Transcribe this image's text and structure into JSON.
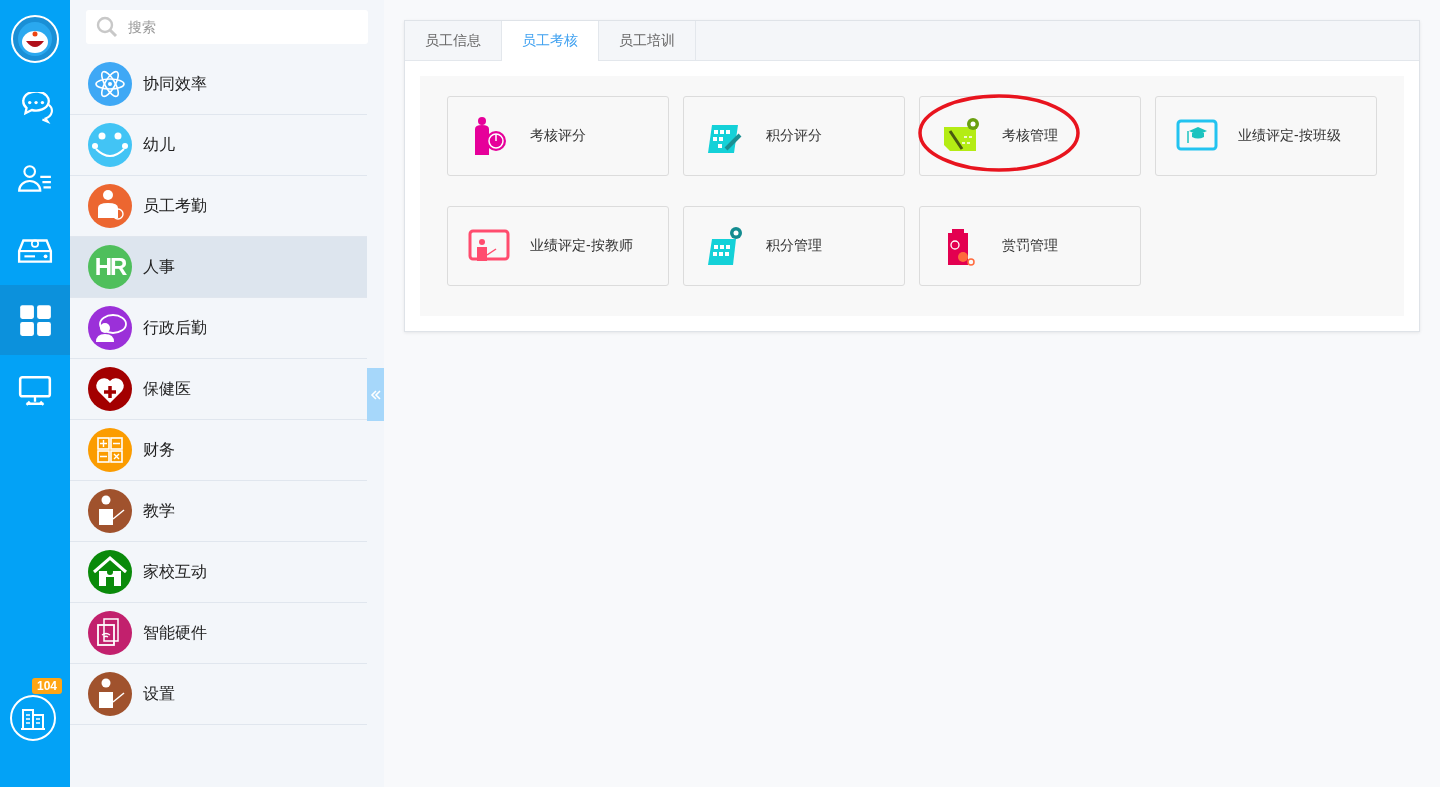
{
  "rail": {
    "items": [
      {
        "kind": "chat",
        "selected": false
      },
      {
        "kind": "contacts",
        "selected": false
      },
      {
        "kind": "drive",
        "selected": false
      },
      {
        "kind": "apps",
        "selected": true
      },
      {
        "kind": "monitor",
        "selected": false
      }
    ],
    "notification_badge": "104"
  },
  "sidebar": {
    "search": {
      "placeholder": "搜索"
    },
    "items": [
      {
        "label": "协同效率",
        "color": "#3ea8f5",
        "selected": false
      },
      {
        "label": "幼儿",
        "color": "#42c4f5",
        "selected": false
      },
      {
        "label": "员工考勤",
        "color": "#ec6630",
        "selected": false
      },
      {
        "label": "人事",
        "color": "#4fbf5c",
        "selected": true,
        "icon_text": "HR"
      },
      {
        "label": "行政后勤",
        "color": "#9b30d9",
        "selected": false
      },
      {
        "label": "保健医",
        "color": "#a30000",
        "selected": false
      },
      {
        "label": "财务",
        "color": "#fb9c00",
        "selected": false
      },
      {
        "label": "教学",
        "color": "#a0522d",
        "selected": false
      },
      {
        "label": "家校互动",
        "color": "#0a8a0a",
        "selected": false
      },
      {
        "label": "智能硬件",
        "color": "#c2206d",
        "selected": false
      },
      {
        "label": "设置",
        "color": "#a0522d",
        "selected": false
      }
    ]
  },
  "tabs": [
    {
      "label": "员工信息",
      "selected": false
    },
    {
      "label": "员工考核",
      "selected": true
    },
    {
      "label": "员工培训",
      "selected": false
    }
  ],
  "cards": [
    {
      "label": "考核评分",
      "highlighted": false
    },
    {
      "label": "积分评分",
      "highlighted": false
    },
    {
      "label": "考核管理",
      "highlighted": true
    },
    {
      "label": "业绩评定-按班级",
      "highlighted": false
    },
    {
      "label": "业绩评定-按教师",
      "highlighted": false
    },
    {
      "label": "积分管理",
      "highlighted": false
    },
    {
      "label": "赏罚管理",
      "highlighted": false
    }
  ]
}
